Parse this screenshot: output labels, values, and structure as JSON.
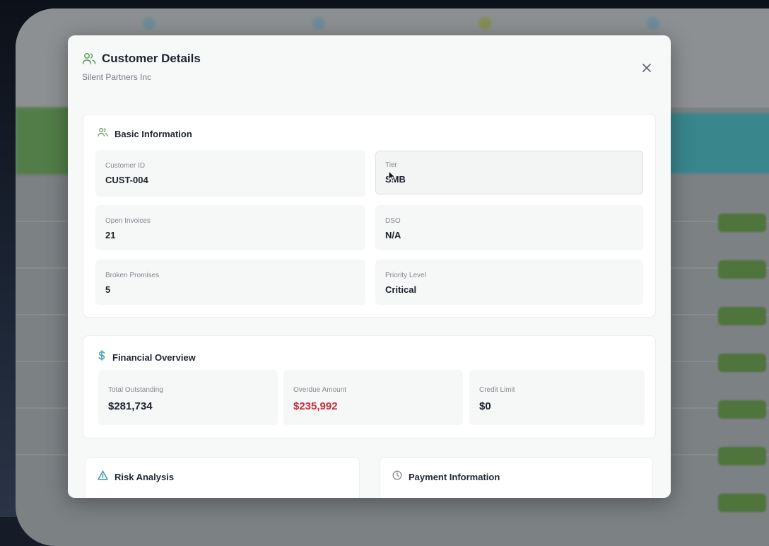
{
  "modal": {
    "title": "Customer Details",
    "subtitle": "Silent Partners Inc",
    "close_icon": "close-icon",
    "title_icon": "users-icon"
  },
  "basic_info": {
    "title": "Basic Information",
    "icon": "users-icon",
    "fields": [
      {
        "label": "Customer ID",
        "value": "CUST-004"
      },
      {
        "label": "Tier",
        "value": "SMB"
      },
      {
        "label": "Open Invoices",
        "value": "21"
      },
      {
        "label": "DSO",
        "value": "N/A"
      },
      {
        "label": "Broken Promises",
        "value": "5"
      },
      {
        "label": "Priority Level",
        "value": "Critical"
      }
    ]
  },
  "financial": {
    "title": "Financial Overview",
    "icon": "dollar-icon",
    "fields": [
      {
        "label": "Total Outstanding",
        "value": "$281,734"
      },
      {
        "label": "Overdue Amount",
        "value": "$235,992"
      },
      {
        "label": "Credit Limit",
        "value": "$0"
      }
    ]
  },
  "risk": {
    "title": "Risk Analysis",
    "icon": "warning-triangle-icon"
  },
  "payment": {
    "title": "Payment Information",
    "icon": "clock-icon"
  },
  "colors": {
    "accent_green": "#5a9a55",
    "accent_teal": "#3aa0b0",
    "overdue_red": "#c62e3d",
    "warning_teal": "#3a9aa8"
  }
}
